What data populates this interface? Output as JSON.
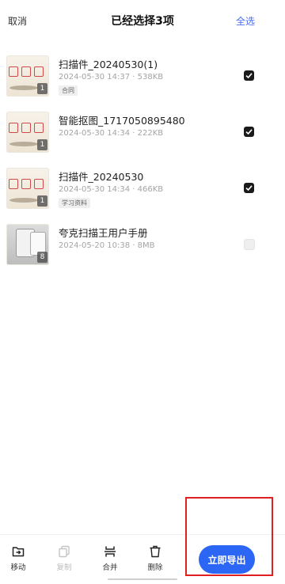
{
  "header": {
    "cancel_label": "取消",
    "title": "已经选择3项",
    "select_all_label": "全选"
  },
  "files": [
    {
      "name": "扫描件_20240530(1)",
      "meta": "2024-05-30 14:37 · 538KB",
      "tag": "合同",
      "page_count": "1",
      "checked": true,
      "thumb_icon": "seal-document-thumbnail"
    },
    {
      "name": "智能抠图_1717050895480",
      "meta": "2024-05-30 14:34 · 222KB",
      "tag": "",
      "page_count": "1",
      "checked": true,
      "thumb_icon": "seal-document-thumbnail"
    },
    {
      "name": "扫描件_20240530",
      "meta": "2024-05-30 14:34 · 466KB",
      "tag": "学习资料",
      "page_count": "1",
      "checked": true,
      "thumb_icon": "seal-document-thumbnail"
    },
    {
      "name": "夸克扫描王用户手册",
      "meta": "2024-05-20 10:38 · 8MB",
      "tag": "",
      "page_count": "8",
      "checked": false,
      "thumb_icon": "phone-manual-thumbnail"
    }
  ],
  "toolbar": {
    "move_label": "移动",
    "copy_label": "复制",
    "merge_label": "合并",
    "delete_label": "删除",
    "export_label": "立即导出"
  },
  "colors": {
    "accent": "#2c66f5",
    "select_all_text": "#4a6cf0",
    "checkbox_checked": "#1a1a1a",
    "highlight_box": "#e02020"
  }
}
